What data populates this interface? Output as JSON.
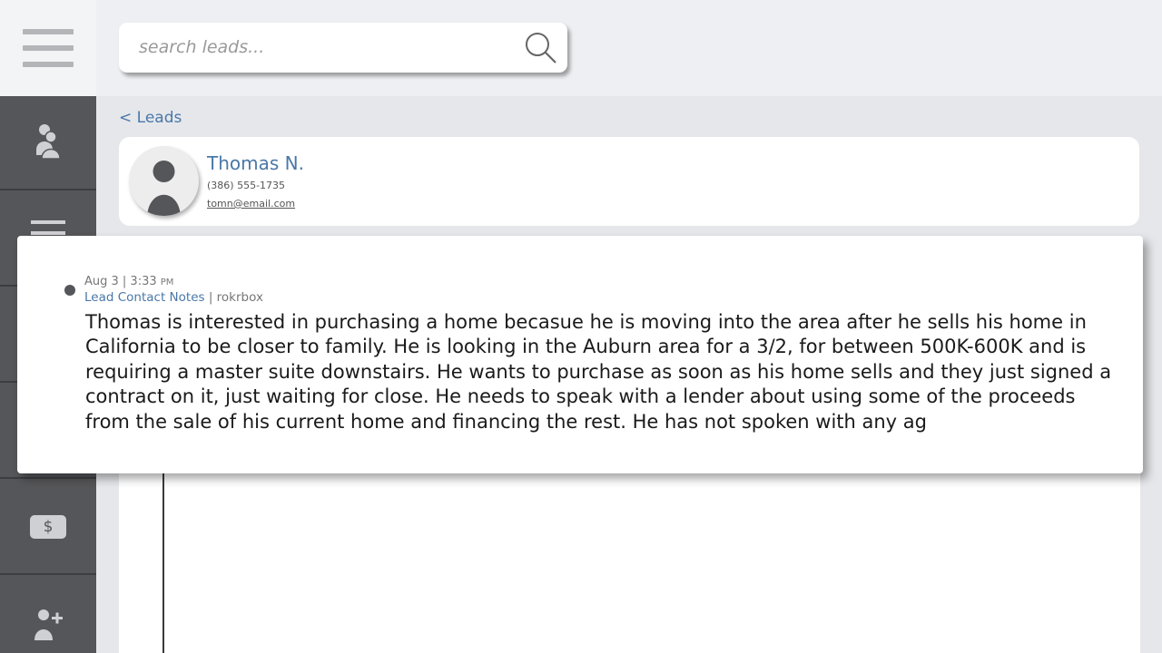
{
  "search": {
    "placeholder": "search leads..."
  },
  "sidebar": {
    "items": [
      {
        "icon": "users-icon"
      },
      {
        "icon": "list-icon"
      },
      {
        "icon": "placeholder-icon"
      },
      {
        "icon": "placeholder-icon"
      },
      {
        "icon": "dollar-icon",
        "label": "$"
      },
      {
        "icon": "add-user-icon"
      }
    ]
  },
  "breadcrumb": {
    "back_label": "< Leads"
  },
  "lead": {
    "name": "Thomas N.",
    "phone": "(386) 555-1735",
    "email": "tomn@email.com"
  },
  "note": {
    "date": "Aug 3 | 3:33",
    "ampm": "PM",
    "type": "Lead Contact Notes",
    "separator": " | ",
    "source": "rokrbox",
    "body": "Thomas is interested in purchasing a home becasue he is moving into the area after he sells his home in California to be closer to family. He is looking in the Auburn area for a 3/2, for between 500K-600K and is requiring a master suite downstairs. He wants to purchase as soon as his home sells and they just signed a contract on it, just waiting for close. He needs to speak with a lender about using some of the proceeds from the sale of his current home and financing the rest. He has not spoken with any ag"
  },
  "colors": {
    "accent": "#4a78a8",
    "sidebar": "#555659",
    "background": "#e6e7eb"
  }
}
